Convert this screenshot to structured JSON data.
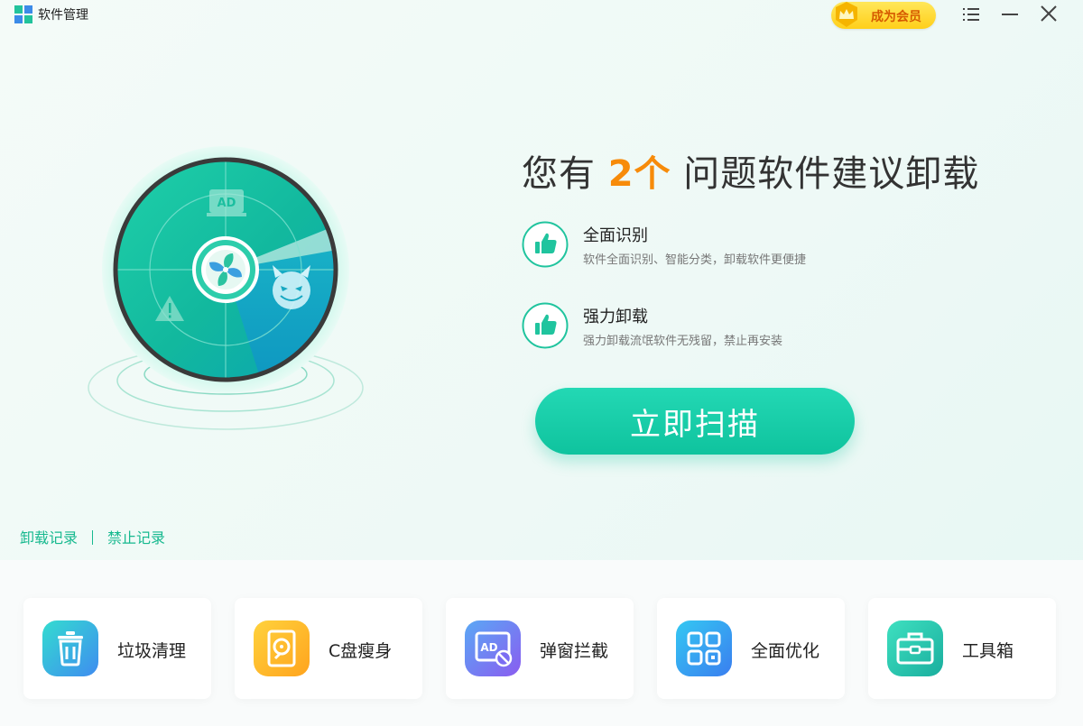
{
  "app": {
    "title": "软件管理"
  },
  "titlebar": {
    "vip_label": "成为会员"
  },
  "hero": {
    "headline_prefix": "您有",
    "issue_count": "2个",
    "headline_suffix": "问题软件建议卸载",
    "features": [
      {
        "title": "全面识别",
        "desc": "软件全面识别、智能分类，卸载软件更便捷"
      },
      {
        "title": "强力卸载",
        "desc": "强力卸载流氓软件无残留，禁止再安装"
      }
    ],
    "scan_label": "立即扫描",
    "radar_ad_text": "AD"
  },
  "links": {
    "uninstall_history": "卸载记录",
    "block_history": "禁止记录"
  },
  "tools": [
    {
      "label": "垃圾清理",
      "icon": "trash-icon"
    },
    {
      "label": "C盘瘦身",
      "icon": "disk-icon"
    },
    {
      "label": "弹窗拦截",
      "icon": "ad-block-icon"
    },
    {
      "label": "全面优化",
      "icon": "grid-optimize-icon"
    },
    {
      "label": "工具箱",
      "icon": "toolbox-icon"
    }
  ],
  "colors": {
    "accent": "#14c89f",
    "highlight": "#f78b0a",
    "vip": "#ffd93a"
  }
}
